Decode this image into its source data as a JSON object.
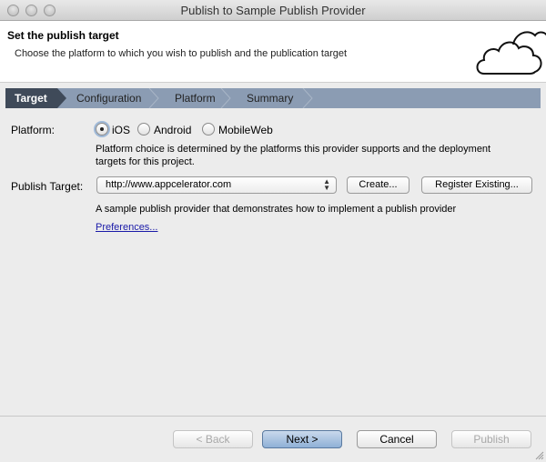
{
  "window": {
    "title": "Publish to Sample Publish Provider"
  },
  "header": {
    "title": "Set the publish target",
    "description": "Choose the platform to which you wish to publish and the publication target",
    "graphic": "cloud-icon"
  },
  "steps": [
    {
      "label": "Target",
      "active": true
    },
    {
      "label": "Configuration",
      "active": false
    },
    {
      "label": "Platform",
      "active": false
    },
    {
      "label": "Summary",
      "active": false
    }
  ],
  "platform": {
    "label": "Platform:",
    "options": [
      {
        "label": "iOS",
        "selected": true
      },
      {
        "label": "Android",
        "selected": false
      },
      {
        "label": "MobileWeb",
        "selected": false
      }
    ],
    "note": "Platform choice is determined by the platforms this provider supports and the deployment targets for this project."
  },
  "publish_target": {
    "label": "Publish Target:",
    "value": "http://www.appcelerator.com",
    "create_label": "Create...",
    "register_label": "Register Existing...",
    "provider_description": "A sample publish provider that demonstrates how to implement a publish provider",
    "preferences_link": "Preferences..."
  },
  "footer": {
    "back_label": "< Back",
    "next_label": "Next >",
    "cancel_label": "Cancel",
    "publish_label": "Publish"
  },
  "colors": {
    "steps_bar": "#8b9cb3",
    "active_step": "#3f4a59",
    "link": "#1a1aa8"
  }
}
